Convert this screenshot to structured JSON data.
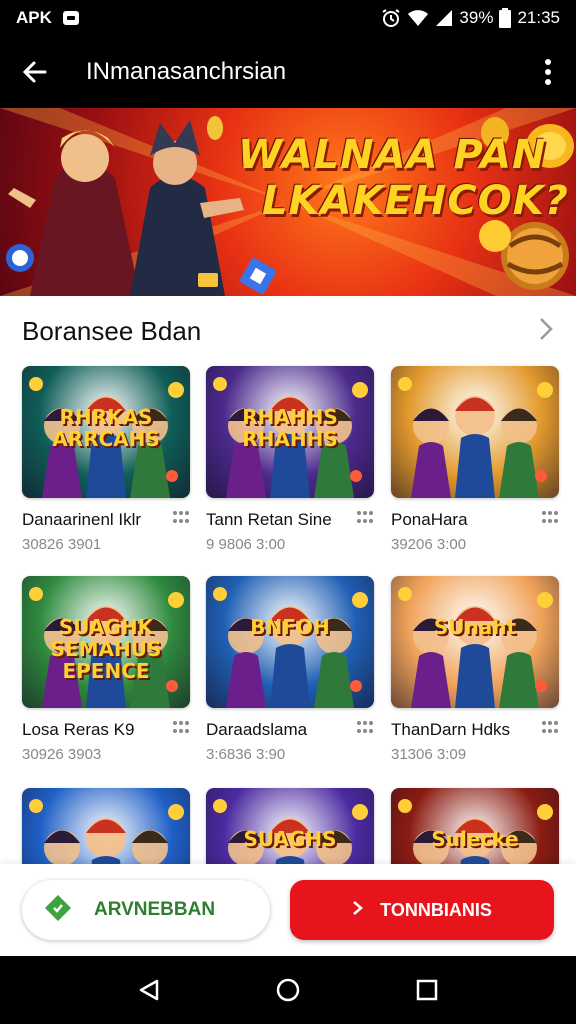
{
  "status_bar": {
    "carrier": "APK",
    "battery": "39%",
    "time": "21:35",
    "icons": [
      "notification-icon",
      "alarm-icon",
      "wifi-icon",
      "signal-icon",
      "battery-icon"
    ]
  },
  "app_bar": {
    "title": "INmanasanchrsian",
    "back_icon": "arrow-left-icon",
    "menu_icon": "more-vertical-icon"
  },
  "banner": {
    "line1": "WALNAA PAN",
    "line2": "LKAKEHCOK?"
  },
  "section": {
    "title": "Boransee Bdan",
    "chevron_icon": "chevron-right-icon"
  },
  "games": [
    {
      "name": "Danaarinenl Iklr",
      "sub": "30826 3901",
      "logo": "RHRKAS ARRCAHS",
      "bg": "#0f5e57"
    },
    {
      "name": "Tann Retan Sine",
      "sub": "9 9806 3:00",
      "logo": "RHAHHS RHAHHS",
      "bg": "#4b2a8c"
    },
    {
      "name": "PonaHara",
      "sub": "39206 3:00",
      "logo": "",
      "bg": "#e39a2d"
    },
    {
      "name": "Losa Reras K9",
      "sub": "30926 3903",
      "logo": "SUAGHK SEMAHUS EPENCE",
      "bg": "#2f8a3e"
    },
    {
      "name": "Daraadslama",
      "sub": "3:6836 3:90",
      "logo": "BNFOH",
      "bg": "#1f5fb3"
    },
    {
      "name": "ThanDarn Hdks",
      "sub": "31306 3:09",
      "logo": "SUnaht",
      "bg": "#f0a35a"
    },
    {
      "name": "",
      "sub": "",
      "logo": "",
      "bg": "#1f5fc6"
    },
    {
      "name": "",
      "sub": "",
      "logo": "SUAGHS",
      "bg": "#4b2aa0"
    },
    {
      "name": "",
      "sub": "",
      "logo": "Sulecke",
      "bg": "#8a1c12"
    }
  ],
  "actions": {
    "secondary_label": "ARVNEBBAN",
    "secondary_icon": "diamond-icon",
    "primary_label": "TONNBIANIS",
    "primary_icon": "chevron-right-icon"
  },
  "nav": [
    "back-triangle-icon",
    "home-circle-icon",
    "recents-square-icon"
  ],
  "colors": {
    "accent": "#e8141c",
    "secondary_text": "#2f7d2f",
    "banner_text": "#ffd323"
  }
}
